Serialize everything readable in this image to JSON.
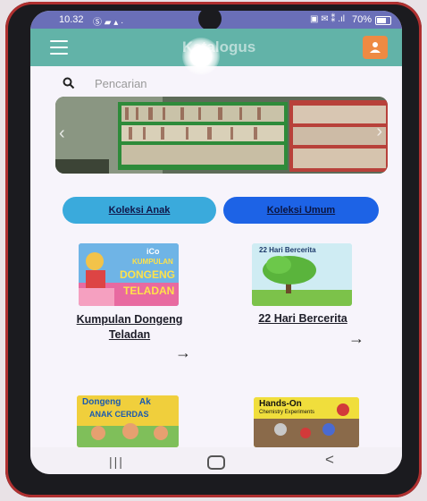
{
  "status": {
    "time": "10.32",
    "left_icons": "Ⓢ ▰ ▴ ·",
    "right_icons": "▣ ✉ ⁑ .ıl",
    "battery": "70%",
    "battery_level": 0.7
  },
  "appbar": {
    "title": "Katalogus",
    "menu_icon": "hamburger-menu-icon",
    "profile_icon": "user-icon",
    "accent": "#62b3a8",
    "profile_color": "#ee8a43"
  },
  "search": {
    "placeholder": "Pencarian",
    "value": ""
  },
  "banner": {
    "image": "library-bookshelves-photo"
  },
  "categories": [
    {
      "label": "Koleksi Anak",
      "color": "#3aaadc"
    },
    {
      "label": "Koleksi Umum",
      "color": "#1d63e6"
    }
  ],
  "books": [
    {
      "title": "Kumpulan Dongeng Teladan",
      "cover_text": [
        "iCo",
        "KUMPULAN",
        "DONGENG",
        "TELADAN"
      ]
    },
    {
      "title": "22 Hari Bercerita",
      "cover_text": [
        "22 Hari Bercerita"
      ]
    },
    {
      "title": "",
      "cover_text": [
        "Dongeng",
        "Ak",
        "ANAK CERDAS"
      ]
    },
    {
      "title": "",
      "cover_text": [
        "Hands-On",
        "Chemistry Experiments"
      ]
    }
  ],
  "nav": {
    "recent": "|||",
    "home": "home-icon",
    "back": "<"
  }
}
